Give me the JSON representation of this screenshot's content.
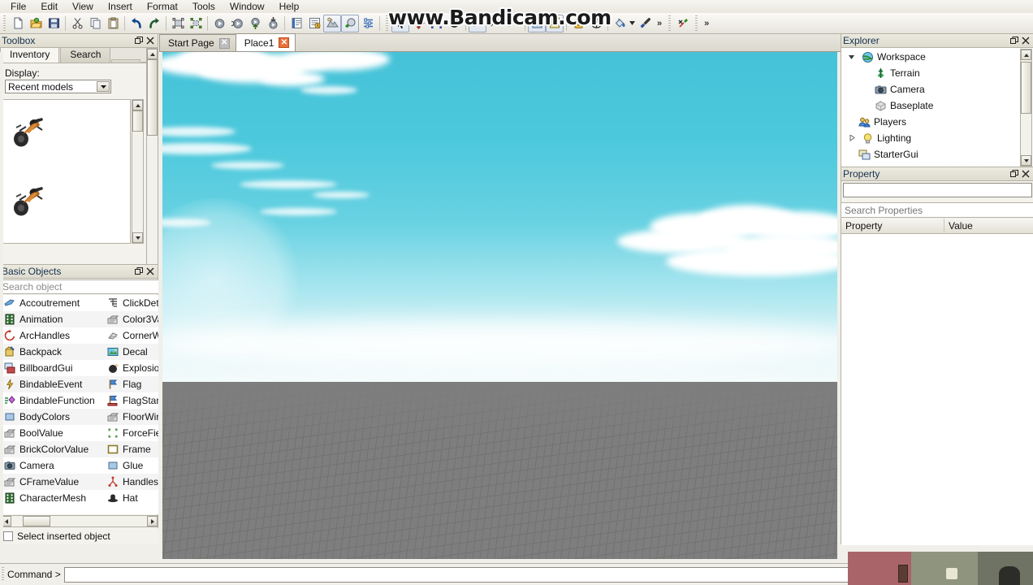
{
  "app": {
    "watermark": "www.Bandicam.com"
  },
  "menubar": {
    "items": [
      {
        "label": "File"
      },
      {
        "label": "Edit"
      },
      {
        "label": "View"
      },
      {
        "label": "Insert"
      },
      {
        "label": "Format"
      },
      {
        "label": "Tools"
      },
      {
        "label": "Window"
      },
      {
        "label": "Help"
      }
    ]
  },
  "toolbar": {
    "buttons": [
      {
        "name": "new-file-icon",
        "title": "New"
      },
      {
        "name": "open-folder-icon",
        "title": "Open"
      },
      {
        "name": "save-icon",
        "title": "Save"
      },
      {
        "name": "cut-icon",
        "title": "Cut"
      },
      {
        "name": "copy-icon",
        "title": "Copy"
      },
      {
        "name": "paste-icon",
        "title": "Paste"
      },
      {
        "name": "undo-icon",
        "title": "Undo"
      },
      {
        "name": "redo-icon",
        "title": "Redo"
      },
      {
        "name": "group-icon",
        "title": "Group"
      },
      {
        "name": "ungroup-icon",
        "title": "Ungroup"
      },
      {
        "name": "run-icon",
        "title": "Run"
      },
      {
        "name": "play-solo-icon",
        "title": "Play Solo"
      },
      {
        "name": "start-server-icon",
        "title": "Start Server"
      },
      {
        "name": "start-player-icon",
        "title": "Start Player"
      },
      {
        "name": "script-icon",
        "title": "Script"
      },
      {
        "name": "script-log-icon",
        "title": "Output"
      },
      {
        "name": "terrain-tool-icon",
        "title": "Terrain"
      },
      {
        "name": "add-terrain-icon",
        "title": "Add Terrain"
      },
      {
        "name": "settings-list-icon",
        "title": "Settings"
      },
      {
        "name": "select-arrow-icon",
        "title": "Select"
      },
      {
        "name": "move-icon",
        "title": "Move"
      },
      {
        "name": "scale-icon",
        "title": "Scale"
      },
      {
        "name": "rotate-icon",
        "title": "Rotate"
      },
      {
        "name": "snap-one-icon",
        "title": "Snap 1"
      },
      {
        "name": "snap-fifth-icon",
        "title": "Snap 1/5"
      },
      {
        "name": "snap-off-icon",
        "title": "Snap Off"
      },
      {
        "name": "collision-icon",
        "title": "Collisions"
      },
      {
        "name": "join-surfaces-icon",
        "title": "Join Surfaces"
      },
      {
        "name": "lock-icon",
        "title": "Lock"
      },
      {
        "name": "anchor-icon",
        "title": "Anchor"
      },
      {
        "name": "paint-bucket-icon",
        "title": "Material"
      },
      {
        "name": "color-picker-icon",
        "title": "Color"
      },
      {
        "name": "plugin-icon",
        "title": "Plugins"
      }
    ],
    "overflow_label": "»"
  },
  "toolbox": {
    "title": "Toolbox",
    "float_icon": "restore-icon",
    "close_icon": "close-icon",
    "tabs": [
      {
        "label": "Inventory",
        "selected": true
      },
      {
        "label": "Search",
        "selected": false
      }
    ],
    "display_label": "Display:",
    "display_value": "Recent models",
    "items": [
      {
        "name": "motorcycle-thumbnail-1"
      },
      {
        "name": "motorcycle-thumbnail-2"
      }
    ]
  },
  "basic_objects": {
    "title": "Basic Objects",
    "float_icon": "restore-icon",
    "close_icon": "close-icon",
    "search_placeholder": "Search object",
    "column1": [
      {
        "label": "Accoutrement",
        "icon": "accoutrement-icon"
      },
      {
        "label": "Animation",
        "icon": "animation-icon"
      },
      {
        "label": "ArcHandles",
        "icon": "archandles-icon"
      },
      {
        "label": "Backpack",
        "icon": "backpack-icon"
      },
      {
        "label": "BillboardGui",
        "icon": "billboardgui-icon"
      },
      {
        "label": "BindableEvent",
        "icon": "bindableevent-icon"
      },
      {
        "label": "BindableFunction",
        "icon": "bindablefunction-icon"
      },
      {
        "label": "BodyColors",
        "icon": "bodycolors-icon"
      },
      {
        "label": "BoolValue",
        "icon": "boolvalue-icon"
      },
      {
        "label": "BrickColorValue",
        "icon": "brickcolorvalue-icon"
      },
      {
        "label": "Camera",
        "icon": "camera-icon"
      },
      {
        "label": "CFrameValue",
        "icon": "cframevalue-icon"
      },
      {
        "label": "CharacterMesh",
        "icon": "charactermesh-icon"
      }
    ],
    "column2": [
      {
        "label": "ClickDete",
        "icon": "clickdetector-icon"
      },
      {
        "label": "Color3Va",
        "icon": "color3value-icon"
      },
      {
        "label": "CornerW",
        "icon": "cornerwedge-icon"
      },
      {
        "label": "Decal",
        "icon": "decal-icon"
      },
      {
        "label": "Explosior",
        "icon": "explosion-icon"
      },
      {
        "label": "Flag",
        "icon": "flag-icon"
      },
      {
        "label": "FlagStan",
        "icon": "flagstand-icon"
      },
      {
        "label": "FloorWir",
        "icon": "floorwire-icon"
      },
      {
        "label": "ForceFiel",
        "icon": "forcefield-icon"
      },
      {
        "label": "Frame",
        "icon": "frame-icon"
      },
      {
        "label": "Glue",
        "icon": "glue-icon"
      },
      {
        "label": "Handles",
        "icon": "handles-icon"
      },
      {
        "label": "Hat",
        "icon": "hat-icon"
      }
    ],
    "select_inserted_label": "Select inserted object",
    "select_inserted_checked": false
  },
  "tabbar": {
    "tabs": [
      {
        "label": "Start Page",
        "selected": false,
        "close_icon": "close-icon"
      },
      {
        "label": "Place1",
        "selected": true,
        "close_icon": "close-icon"
      }
    ],
    "close_all_icon": "close-document-icon"
  },
  "viewport": {
    "name": "3d-viewport",
    "sky_color": "#4ec8dc",
    "ground_color": "#7e7e7e"
  },
  "explorer": {
    "title": "Explorer",
    "float_icon": "restore-icon",
    "close_icon": "close-icon",
    "nodes": [
      {
        "label": "Workspace",
        "depth": 0,
        "twisty": "expanded",
        "icon": "workspace-icon"
      },
      {
        "label": "Terrain",
        "depth": 1,
        "twisty": "none",
        "icon": "terrain-icon"
      },
      {
        "label": "Camera",
        "depth": 1,
        "twisty": "none",
        "icon": "camera-icon"
      },
      {
        "label": "Baseplate",
        "depth": 1,
        "twisty": "none",
        "icon": "part-icon"
      },
      {
        "label": "Players",
        "depth": 0,
        "twisty": "none",
        "icon": "players-icon"
      },
      {
        "label": "Lighting",
        "depth": 0,
        "twisty": "collapsed",
        "icon": "lighting-icon"
      },
      {
        "label": "StarterGui",
        "depth": 0,
        "twisty": "none",
        "icon": "startergui-icon"
      }
    ]
  },
  "property": {
    "title": "Property",
    "float_icon": "restore-icon",
    "close_icon": "close-icon",
    "selected_object": "",
    "search_placeholder": "Search Properties",
    "columns": [
      "Property",
      "Value"
    ],
    "rows": []
  },
  "command_bar": {
    "label": "Command >",
    "value": ""
  },
  "webcam": {
    "name": "webcam-overlay"
  },
  "colors": {
    "sky": "#4ec8dc",
    "ground": "#7e7e7e",
    "chrome": "#f0efe9",
    "accent_tab": "#e8703a",
    "close_red": "#c0392b"
  }
}
